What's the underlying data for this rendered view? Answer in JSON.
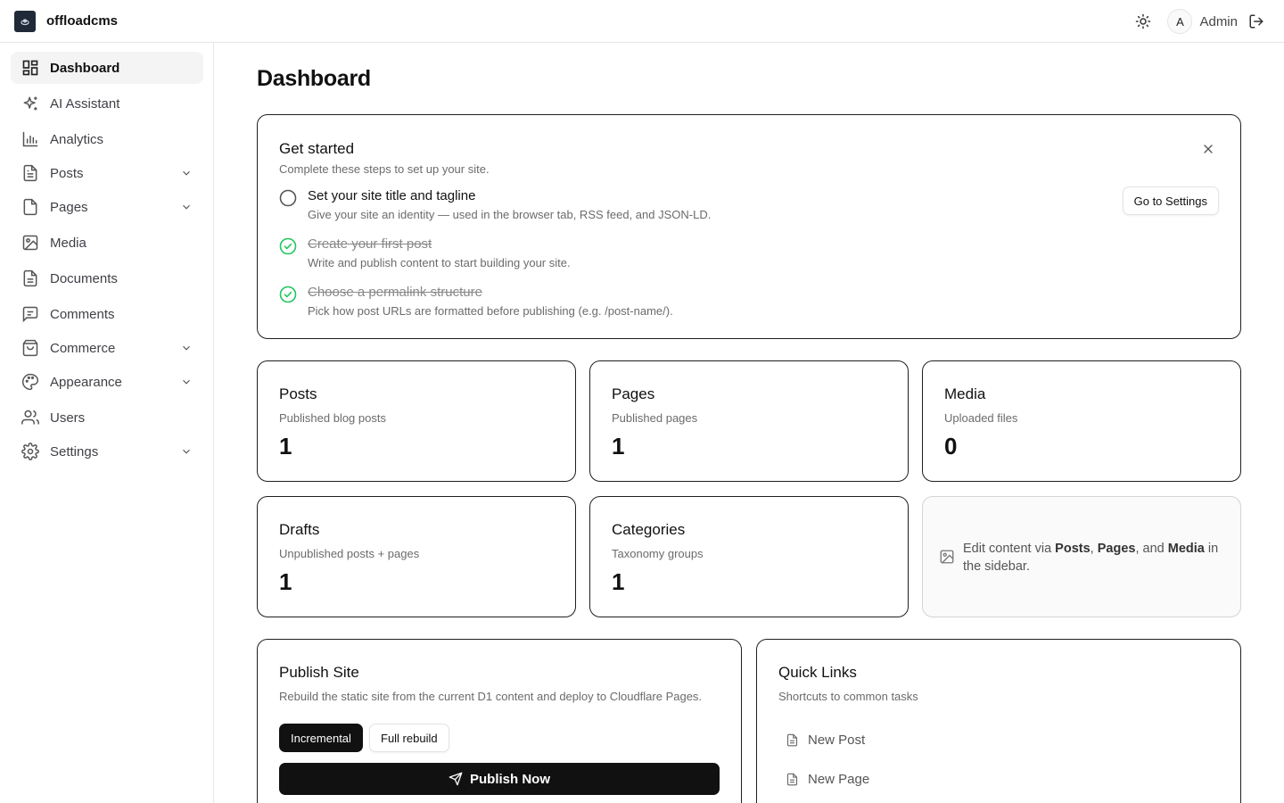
{
  "app": {
    "brand": "offloadcms"
  },
  "header": {
    "avatar_initial": "A",
    "user_name": "Admin"
  },
  "sidebar": {
    "items": [
      {
        "label": "Dashboard",
        "icon": "dashboard-icon",
        "active": true
      },
      {
        "label": "AI Assistant",
        "icon": "sparkles-icon"
      },
      {
        "label": "Analytics",
        "icon": "bar-chart-icon"
      },
      {
        "label": "Posts",
        "icon": "file-text-icon",
        "expandable": true
      },
      {
        "label": "Pages",
        "icon": "file-icon",
        "expandable": true
      },
      {
        "label": "Media",
        "icon": "image-icon"
      },
      {
        "label": "Documents",
        "icon": "document-icon"
      },
      {
        "label": "Comments",
        "icon": "message-square-icon"
      },
      {
        "label": "Commerce",
        "icon": "shopping-bag-icon",
        "expandable": true
      },
      {
        "label": "Appearance",
        "icon": "palette-icon",
        "expandable": true
      },
      {
        "label": "Users",
        "icon": "users-icon"
      },
      {
        "label": "Settings",
        "icon": "gear-icon",
        "expandable": true
      }
    ]
  },
  "main": {
    "title": "Dashboard",
    "get_started": {
      "title": "Get started",
      "subtitle": "Complete these steps to set up your site.",
      "action_label": "Go to Settings",
      "steps": [
        {
          "title": "Set your site title and tagline",
          "desc": "Give your site an identity — used in the browser tab, RSS feed, and JSON-LD.",
          "done": false
        },
        {
          "title": "Create your first post",
          "desc": "Write and publish content to start building your site.",
          "done": true
        },
        {
          "title": "Choose a permalink structure",
          "desc": "Pick how post URLs are formatted before publishing (e.g. /post-name/).",
          "done": true
        }
      ]
    },
    "stats": [
      {
        "title": "Posts",
        "subtitle": "Published blog posts",
        "value": "1"
      },
      {
        "title": "Pages",
        "subtitle": "Published pages",
        "value": "1"
      },
      {
        "title": "Media",
        "subtitle": "Uploaded files",
        "value": "0"
      },
      {
        "title": "Drafts",
        "subtitle": "Unpublished posts + pages",
        "value": "1"
      },
      {
        "title": "Categories",
        "subtitle": "Taxonomy groups",
        "value": "1"
      }
    ],
    "hint": {
      "t1": "Edit content via ",
      "b1": "Posts",
      "t2": ", ",
      "b2": "Pages",
      "t3": ", and ",
      "b3": "Media",
      "t4": " in the sidebar."
    },
    "publish": {
      "title": "Publish Site",
      "subtitle": "Rebuild the static site from the current D1 content and deploy to Cloudflare Pages.",
      "mode_incremental": "Incremental",
      "mode_full": "Full rebuild",
      "publish_label": "Publish Now"
    },
    "quick_links": {
      "title": "Quick Links",
      "subtitle": "Shortcuts to common tasks",
      "items": [
        {
          "label": "New Post"
        },
        {
          "label": "New Page"
        }
      ]
    }
  }
}
